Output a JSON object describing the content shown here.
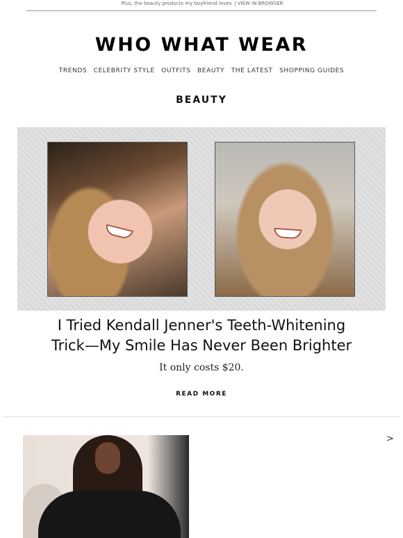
{
  "preheader": {
    "text": "Plus, the beauty products my boyfriend loves",
    "separator": "|",
    "view_in_browser": "VIEW IN BROWSER"
  },
  "brand": {
    "logo_text": "WHO WHAT WEAR"
  },
  "nav": {
    "items": [
      "TRENDS",
      "CELEBRITY STYLE",
      "OUTFITS",
      "BEAUTY",
      "THE LATEST",
      "SHOPPING GUIDES"
    ]
  },
  "section_title": "BEAUTY",
  "feature": {
    "headline_line1": "I Tried Kendall Jenner's Teeth-Whitening",
    "headline_line2": "Trick—My Smile Has Never Been Brighter",
    "dek": "It only costs $20.",
    "cta": "READ MORE"
  },
  "carousel": {
    "next_label": ">"
  }
}
